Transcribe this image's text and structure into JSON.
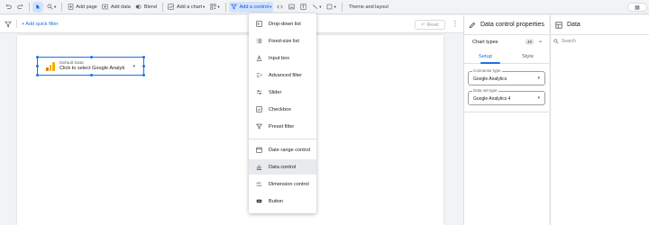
{
  "toolbar": {
    "add_page": "Add page",
    "add_data": "Add data",
    "blend": "Blend",
    "add_chart": "Add a chart",
    "add_control": "Add a control",
    "theme_layout": "Theme and layout"
  },
  "filterbar": {
    "add_quick_filter": "+ Add quick filter",
    "reset": "Reset"
  },
  "widget": {
    "line1": "Default Data",
    "line2": "Click to select Google Analyti"
  },
  "menu": {
    "items": [
      {
        "label": "Drop-down list",
        "icon": "dropdown-list-icon"
      },
      {
        "label": "Fixed-size list",
        "icon": "list-icon"
      },
      {
        "label": "Input box",
        "icon": "input-box-icon"
      },
      {
        "label": "Advanced filter",
        "icon": "advanced-filter-icon"
      },
      {
        "label": "Slider",
        "icon": "slider-icon"
      },
      {
        "label": "Checkbox",
        "icon": "checkbox-icon"
      },
      {
        "label": "Preset filter",
        "icon": "preset-filter-icon"
      },
      {
        "label": "Date range control",
        "icon": "calendar-icon"
      },
      {
        "label": "Data control",
        "icon": "data-control-icon"
      },
      {
        "label": "Dimension control",
        "icon": "dimension-control-icon"
      },
      {
        "label": "Button",
        "icon": "button-icon"
      }
    ]
  },
  "props": {
    "title": "Data control properties",
    "chart_types": "Chart types",
    "chart_types_badge": "48",
    "tab_setup": "Setup",
    "tab_style": "Style",
    "connector_label": "Connector type",
    "connector_value": "Google Analytics",
    "dataset_label": "Data set type",
    "dataset_value": "Google Analytics 4"
  },
  "data_panel": {
    "title": "Data",
    "search_placeholder": "Search"
  },
  "colors": {
    "accent": "#1a73e8",
    "ga_orange": "#f9ab00",
    "ga_dark_orange": "#e37400"
  }
}
